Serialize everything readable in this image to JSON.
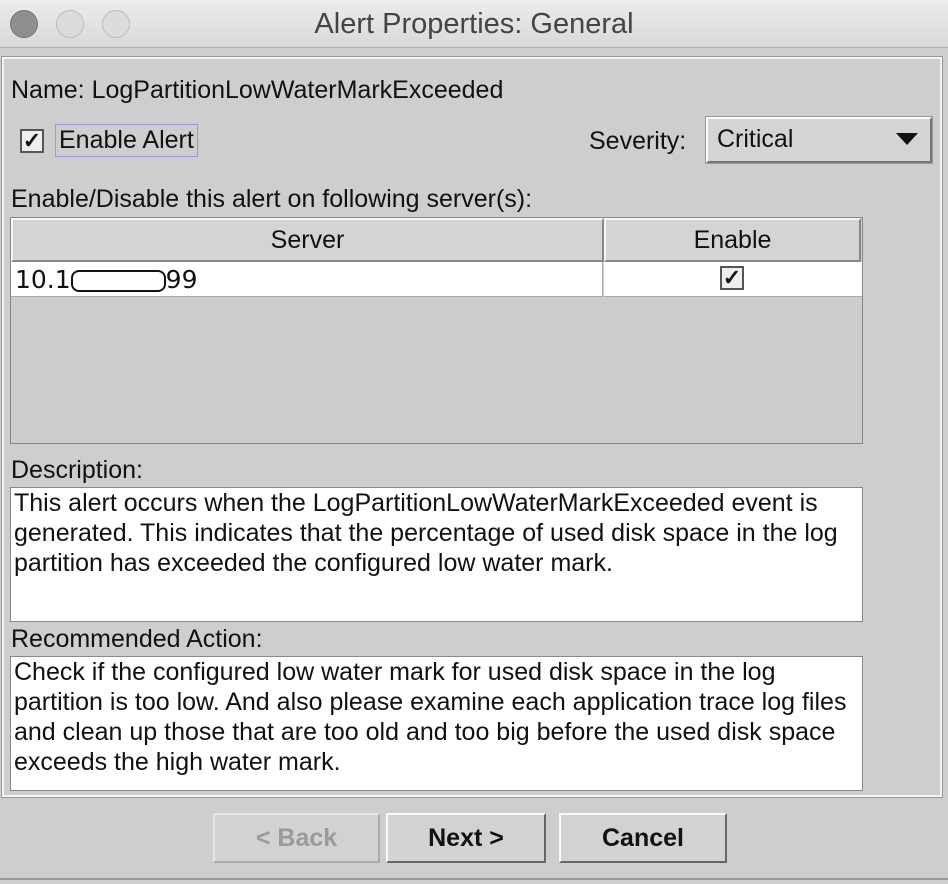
{
  "window": {
    "title": "Alert Properties: General"
  },
  "name_label": "Name: LogPartitionLowWaterMarkExceeded",
  "enable_alert": {
    "label": "Enable Alert",
    "checked": true
  },
  "severity": {
    "label": "Severity:",
    "value": "Critical"
  },
  "servers_label": "Enable/Disable this alert on following server(s):",
  "table": {
    "headers": [
      "Server",
      "Enable"
    ],
    "rows": [
      {
        "server_prefix": "10.1",
        "server_suffix": "99",
        "enabled": true
      }
    ]
  },
  "description": {
    "label": "Description:",
    "text": "This alert occurs when the LogPartitionLowWaterMarkExceeded event is generated. This indicates that the percentage of used disk space in the log partition has exceeded the configured low water mark."
  },
  "recommended": {
    "label": "Recommended Action:",
    "text": "Check if the configured low water mark for used disk space in the log partition is too low. And also please examine each application trace log files and clean up those that are too old and too big before the used disk space exceeds the high water mark."
  },
  "buttons": {
    "back": "< Back",
    "next": "Next >",
    "cancel": "Cancel"
  },
  "check_glyph": "✓"
}
